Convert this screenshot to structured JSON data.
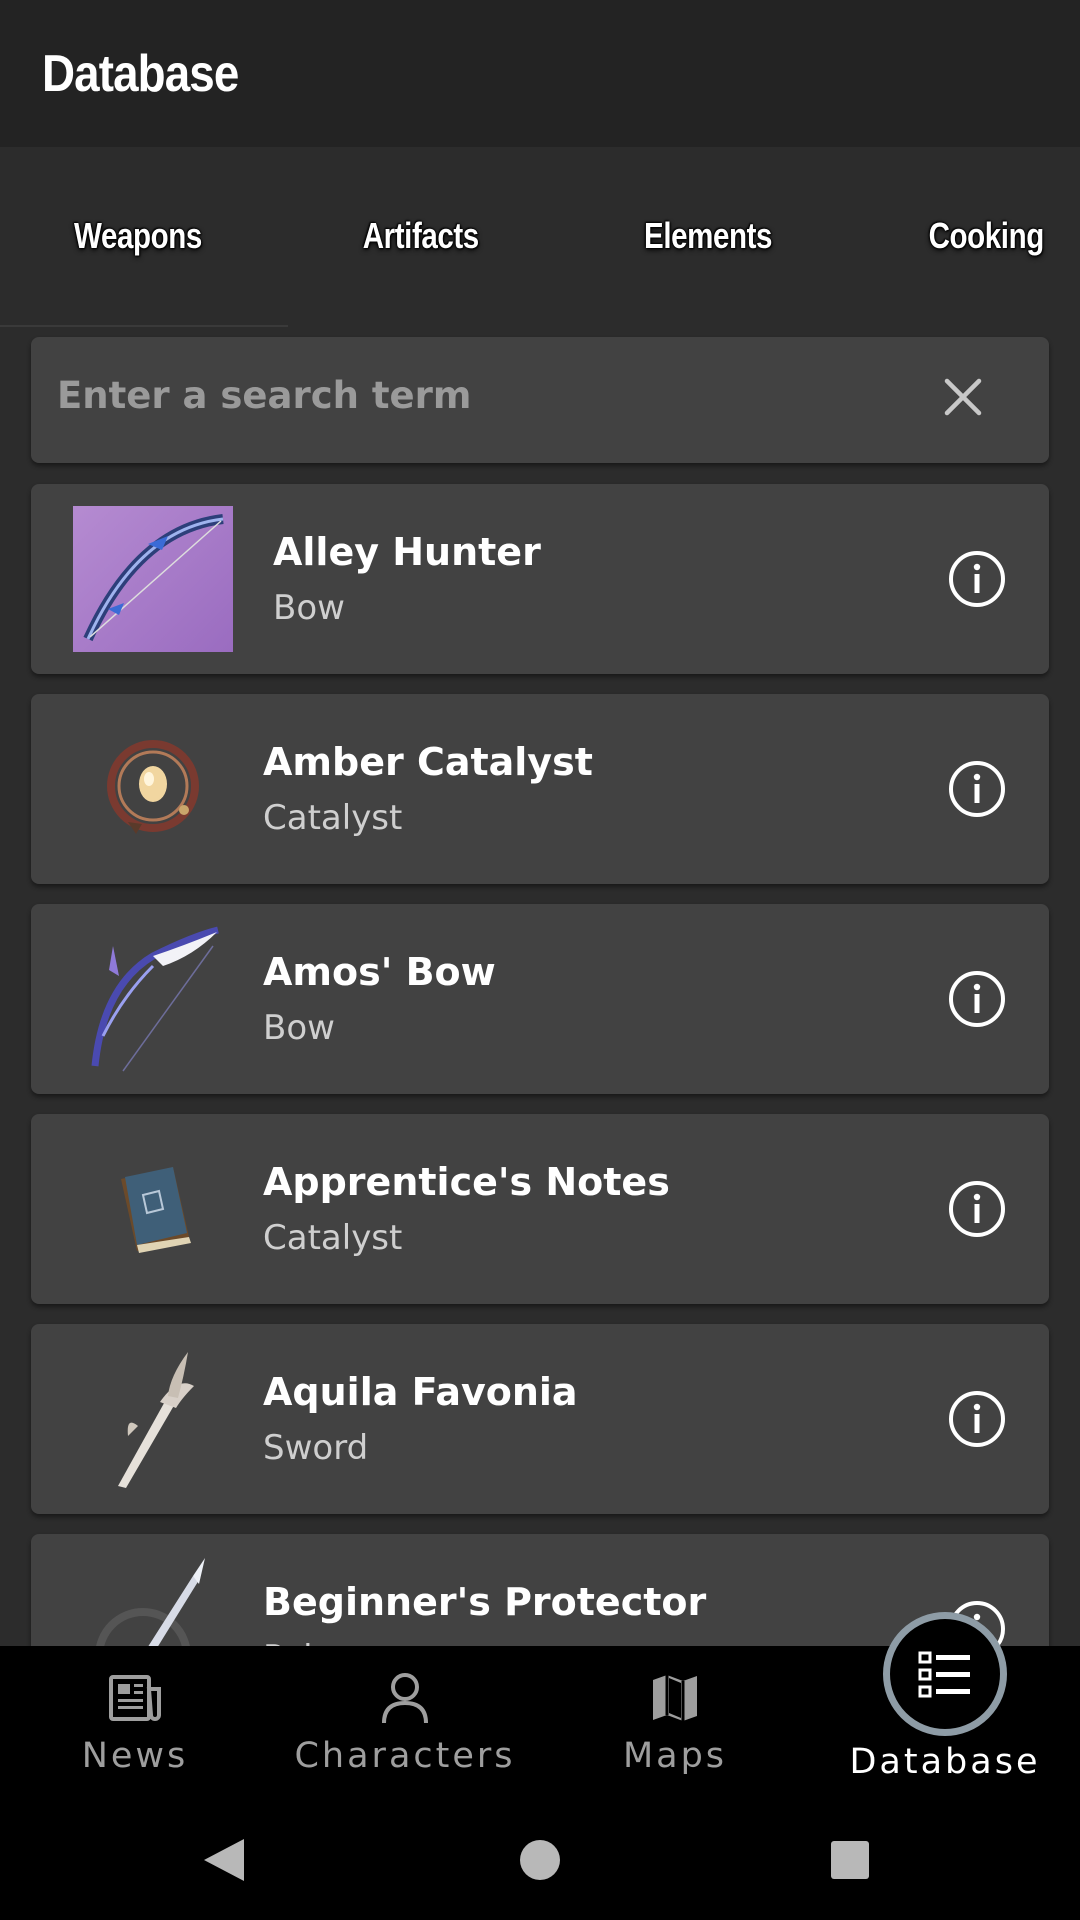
{
  "appbar": {
    "title": "Database"
  },
  "tabs": [
    {
      "label": "Weapons"
    },
    {
      "label": "Artifacts"
    },
    {
      "label": "Elements"
    },
    {
      "label": "Cooking"
    }
  ],
  "search": {
    "placeholder": "Enter a search term",
    "value": ""
  },
  "items": [
    {
      "name": "Alley Hunter",
      "type": "Bow",
      "icon": "bow-icon"
    },
    {
      "name": "Amber Catalyst",
      "type": "Catalyst",
      "icon": "catalyst-orb-icon"
    },
    {
      "name": "Amos' Bow",
      "type": "Bow",
      "icon": "bow-icon"
    },
    {
      "name": "Apprentice's Notes",
      "type": "Catalyst",
      "icon": "book-icon"
    },
    {
      "name": "Aquila Favonia",
      "type": "Sword",
      "icon": "sword-icon"
    },
    {
      "name": "Beginner's Protector",
      "type": "Polearm",
      "icon": "polearm-icon"
    }
  ],
  "bottom_nav": [
    {
      "label": "News",
      "icon": "newspaper-icon"
    },
    {
      "label": "Characters",
      "icon": "person-icon"
    },
    {
      "label": "Maps",
      "icon": "map-icon"
    },
    {
      "label": "Database",
      "icon": "list-icon",
      "active": true
    }
  ],
  "colors": {
    "background": "#2c2c2c",
    "appbar": "#232323",
    "card": "#424242",
    "nav": "#000000",
    "fab_ring": "#8e9ca6"
  }
}
